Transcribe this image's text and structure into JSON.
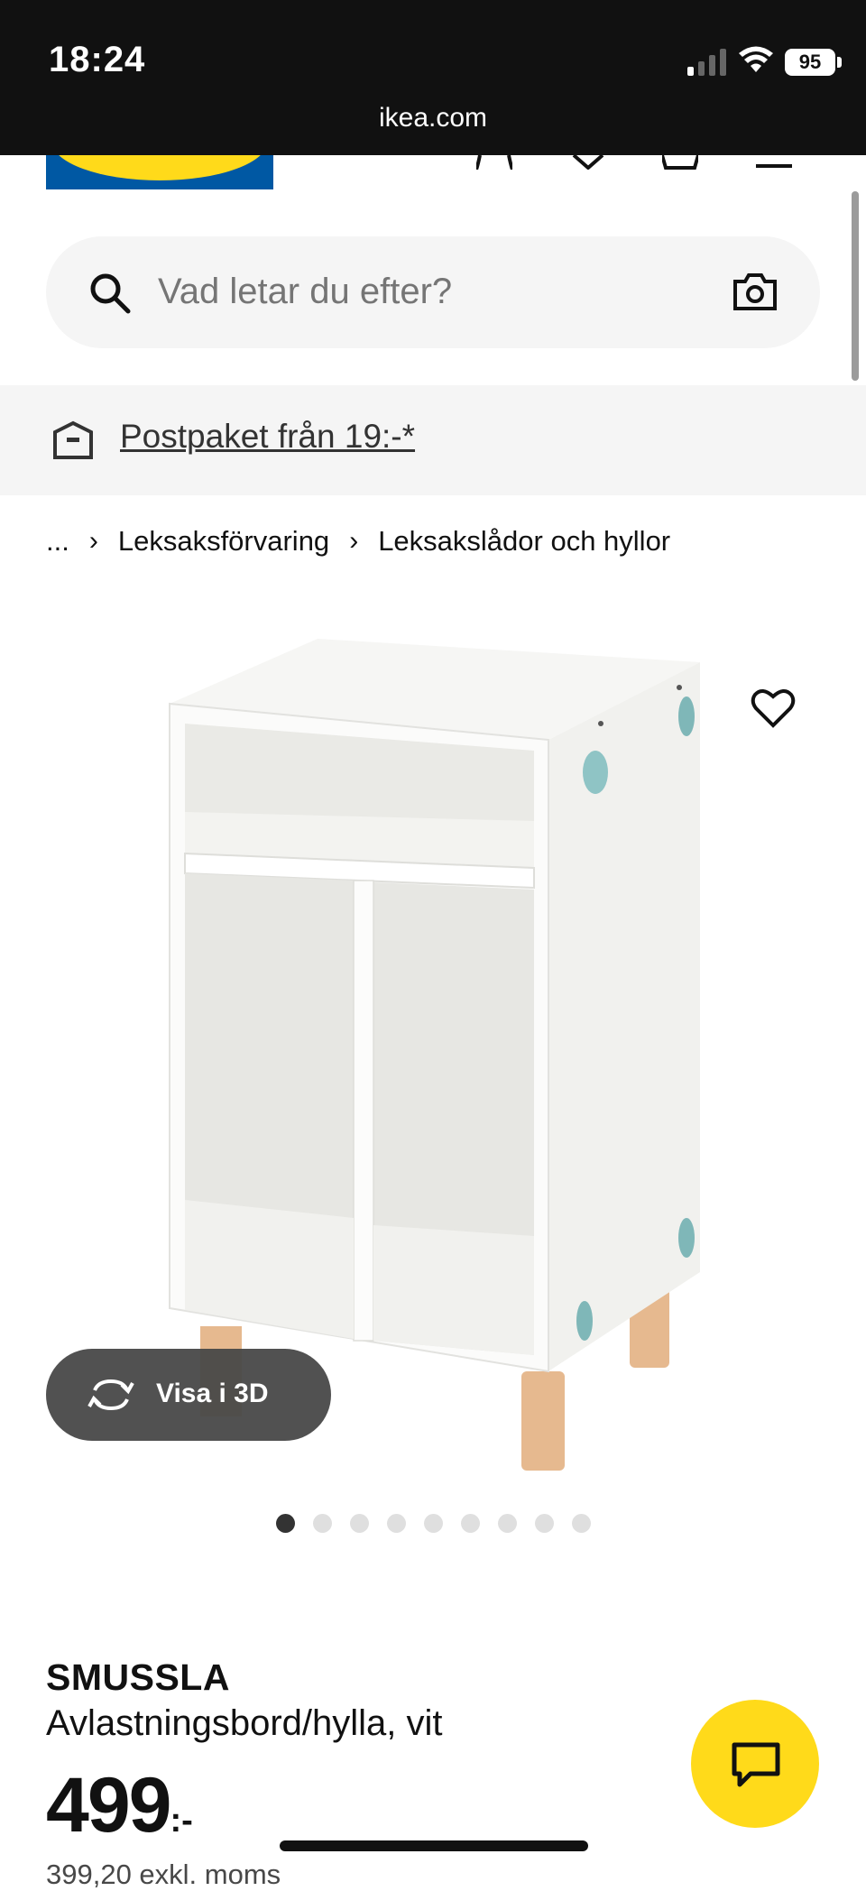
{
  "status_bar": {
    "time": "18:24",
    "url": "ikea.com",
    "battery": "95",
    "icons": [
      "signal-icon",
      "wifi-icon",
      "battery-icon"
    ]
  },
  "header": {
    "logo_text": "IKEA",
    "icons": [
      "user-icon",
      "heart-icon",
      "bag-icon",
      "menu-icon"
    ]
  },
  "search": {
    "placeholder": "Vad letar du efter?",
    "icons": [
      "search-icon",
      "camera-icon"
    ]
  },
  "promo": {
    "label": "Postpaket från 19:-*",
    "icon": "box-icon"
  },
  "breadcrumb": {
    "items": [
      "...",
      "Leksaksförvaring",
      "Leksakslådor och hyllor"
    ]
  },
  "gallery": {
    "view_3d_label": "Visa i 3D",
    "dot_count": 9,
    "active_index": 0
  },
  "product": {
    "name": "SMUSSLA",
    "description": "Avlastningsbord/hylla, vit",
    "price": "499",
    "price_suffix": ":-",
    "price_ex_vat": "399,20 exkl. moms"
  },
  "colors": {
    "ikea_blue": "#0058a3",
    "ikea_yellow": "#ffda1a",
    "knob_teal": "#7fb7b8",
    "wood_leg": "#e6b98f"
  }
}
